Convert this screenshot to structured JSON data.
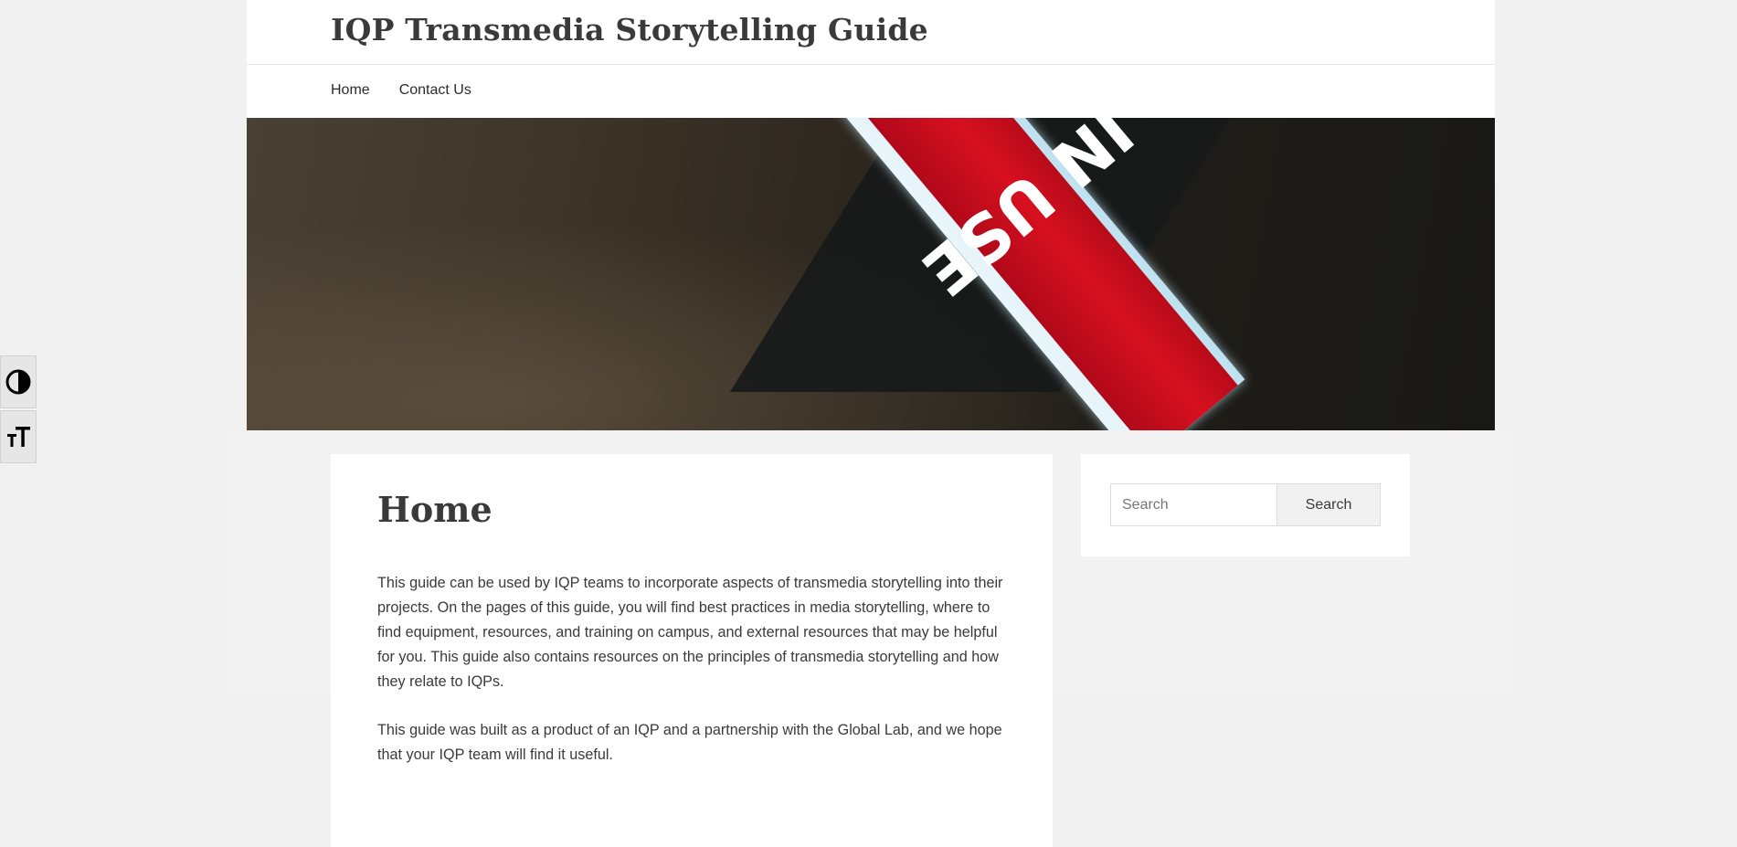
{
  "site": {
    "title": "IQP Transmedia Storytelling Guide"
  },
  "nav": {
    "items": [
      {
        "label": "Home"
      },
      {
        "label": "Contact Us"
      }
    ]
  },
  "hero": {
    "sign_text": "IN USE",
    "colors": {
      "sign_red": "#d7101f",
      "sign_frame": "#e9f6fb"
    }
  },
  "main": {
    "page_title": "Home",
    "paragraphs": [
      "This guide can be used by IQP teams to incorporate aspects of transmedia storytelling into their projects. On the pages of this guide, you will find best practices in media storytelling, where to find equipment, resources, and training on campus, and external resources that may be helpful for you. This guide also contains resources on the principles of transmedia storytelling and how they relate to IQPs.",
      "This guide was built as a product of an IQP and a partnership with the Global Lab, and we hope that your IQP team will find it useful."
    ]
  },
  "sidebar": {
    "search": {
      "placeholder": "Search",
      "button_label": "Search"
    }
  },
  "accessibility": {
    "icons": [
      "contrast-icon",
      "text-size-icon"
    ]
  }
}
